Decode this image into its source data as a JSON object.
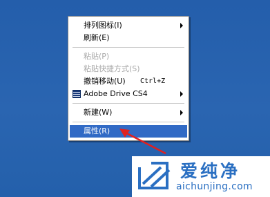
{
  "context_menu": {
    "items": [
      {
        "label": "排列图标(I)",
        "has_submenu": true
      },
      {
        "label": "刷新(E)"
      },
      {
        "label": "粘贴(P)",
        "disabled": true
      },
      {
        "label": "粘贴快捷方式(S)",
        "disabled": true
      },
      {
        "label": "撤销移动(U)",
        "shortcut": "Ctrl+Z"
      },
      {
        "label": "Adobe Drive CS4",
        "has_submenu": true,
        "icon": "adobe-drive-icon"
      },
      {
        "label": "新建(W)",
        "has_submenu": true
      },
      {
        "label": "属性(R)",
        "selected": true
      }
    ]
  },
  "annotation": {
    "color": "#e02020",
    "icon": "red-arrow"
  },
  "watermark": {
    "name": "爱纯净",
    "url": "aichunjing.com",
    "color": "#2a6fc2"
  }
}
